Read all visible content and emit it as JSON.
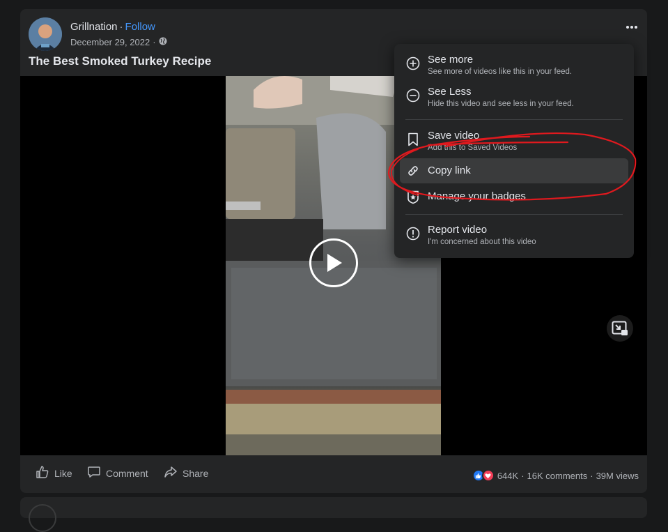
{
  "post": {
    "author": "Grillnation",
    "separator": "·",
    "follow_label": "Follow",
    "date": "December 29, 2022",
    "audience_icon": "globe-icon",
    "title": "The Best Smoked Turkey Recipe",
    "more_icon": "more-options-icon"
  },
  "video": {
    "play_icon": "play-icon",
    "pip_icon": "picture-in-picture-icon"
  },
  "actions": {
    "like_label": "Like",
    "comment_label": "Comment",
    "share_label": "Share"
  },
  "stats": {
    "reactions": "644K",
    "comments": "16K comments",
    "dot": "·",
    "views": "39M views"
  },
  "menu": {
    "items": [
      {
        "label": "See more",
        "sub": "See more of videos like this in your feed.",
        "icon": "plus-circle-icon"
      },
      {
        "label": "See Less",
        "sub": "Hide this video and see less in your feed.",
        "icon": "minus-circle-icon"
      },
      {
        "label": "Save video",
        "sub": "Add this to Saved Videos",
        "icon": "bookmark-icon"
      },
      {
        "label": "Copy link",
        "sub": "",
        "icon": "link-icon"
      },
      {
        "label": "Manage your badges",
        "sub": "",
        "icon": "badge-icon"
      },
      {
        "label": "Report video",
        "sub": "I'm concerned about this video",
        "icon": "report-icon"
      }
    ],
    "highlighted": "Copy link"
  },
  "colors": {
    "background": "#18191a",
    "card": "#242526",
    "accent": "#4599ff",
    "annotation": "#e0191e"
  }
}
